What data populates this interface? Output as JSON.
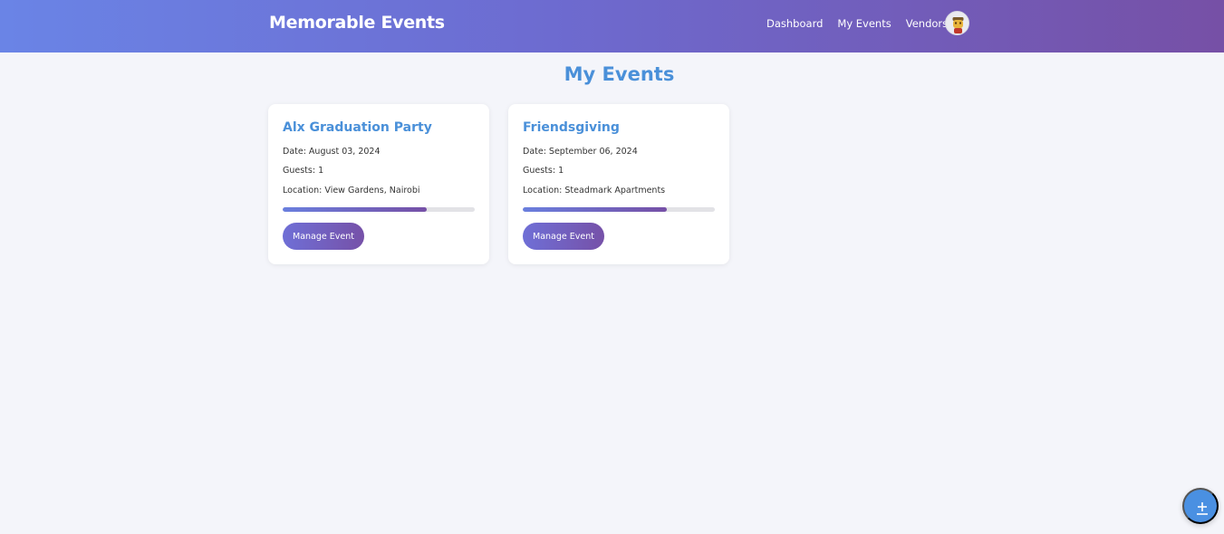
{
  "header": {
    "brand": "Memorable Events",
    "nav": [
      {
        "label": "Dashboard"
      },
      {
        "label": "My Events"
      },
      {
        "label": "Vendors"
      }
    ],
    "avatar_icon": "user-avatar-icon"
  },
  "main": {
    "title": "My Events",
    "events": [
      {
        "title": "Alx Graduation Party",
        "date": "Date: August 03, 2024",
        "guests": "Guests: 1",
        "location": "Location: View Gardens, Nairobi",
        "progress": 0.75,
        "button_label": "Manage Event"
      },
      {
        "title": "Friendsgiving",
        "date": "Date: September 06, 2024",
        "guests": "Guests: 1",
        "location": "Location: Steadmark Apartments",
        "progress": 0.75,
        "button_label": "Manage Event"
      }
    ]
  },
  "fab": {
    "icon": "add-event-icon"
  },
  "colors": {
    "accent": "#4a90d9",
    "header_start": "#6a84e6",
    "header_end": "#7650a6",
    "background": "#f4f5fa"
  }
}
